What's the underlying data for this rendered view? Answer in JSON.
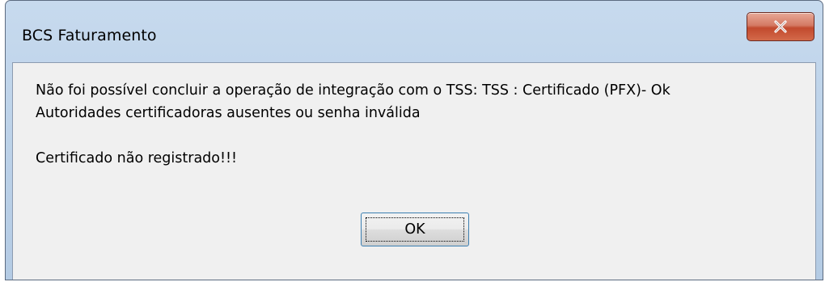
{
  "window": {
    "title": "BCS Faturamento",
    "close_icon": "close-icon"
  },
  "message": {
    "line1": "Não foi possível concluir a operação de integração com o TSS: TSS : Certificado (PFX)- Ok",
    "line2": "Autoridades certificadoras ausentes ou senha inválida",
    "line3": "Certificado não registrado!!!"
  },
  "buttons": {
    "ok_label": "OK"
  },
  "colors": {
    "close_button": "#c24a2e",
    "frame": "#bfd4ea",
    "client": "#f0f0f0"
  }
}
